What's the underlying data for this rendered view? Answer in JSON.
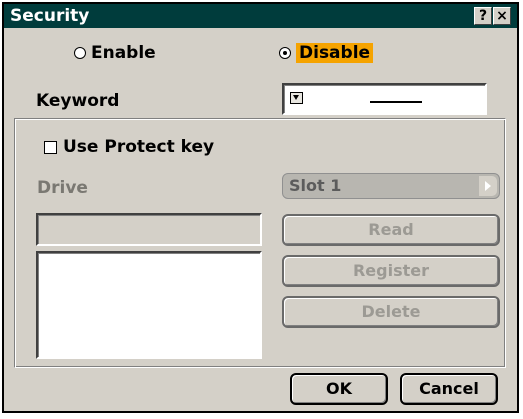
{
  "window": {
    "title": "Security",
    "help_glyph": "?",
    "close_glyph": "×"
  },
  "security_mode": {
    "enable_label": "Enable",
    "disable_label": "Disable",
    "selected": "Disable"
  },
  "keyword": {
    "label": "Keyword",
    "value": "",
    "dropdown_icon": "dropdown-icon"
  },
  "protect_key": {
    "checkbox_label": "Use Protect key",
    "checked": false,
    "drive_label": "Drive",
    "drive_value": "Slot 1",
    "key_field_value": "",
    "key_list_items": [],
    "read_label": "Read",
    "register_label": "Register",
    "delete_label": "Delete"
  },
  "footer": {
    "ok_label": "OK",
    "cancel_label": "Cancel"
  },
  "colors": {
    "title_bar": "#003c3c",
    "dialog_bg": "#d4d0c8",
    "highlight": "#f5a300",
    "disabled_text": "#9c9a94"
  }
}
